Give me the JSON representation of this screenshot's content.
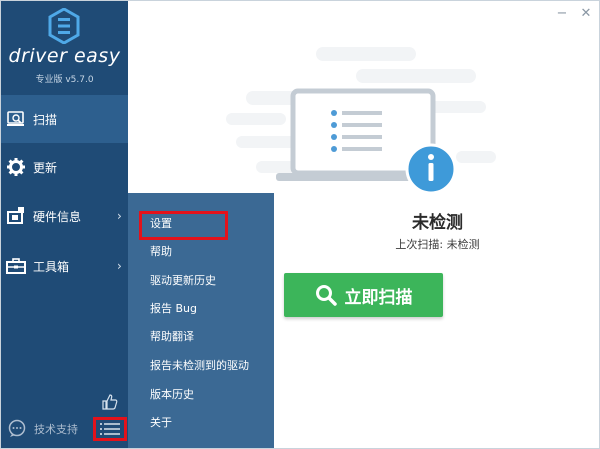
{
  "brand": {
    "name": "driver easy",
    "version": "专业版 v5.7.0"
  },
  "sidebar": {
    "items": [
      {
        "label": "扫描",
        "icon": "scan-icon"
      },
      {
        "label": "更新",
        "icon": "gear-icon"
      },
      {
        "label": "硬件信息",
        "icon": "hardware-info-icon"
      },
      {
        "label": "工具箱",
        "icon": "toolbox-icon"
      }
    ],
    "support_label": "技术支持",
    "active_index": 0
  },
  "dropdown": {
    "items": [
      "设置",
      "帮助",
      "驱动更新历史",
      "报告 Bug",
      "帮助翻译",
      "报告未检测到的驱动",
      "版本历史",
      "关于"
    ]
  },
  "window": {
    "minimize": "−",
    "close": "✕"
  },
  "main": {
    "status_title": "未检测",
    "last_scan": "上次扫描: 未检测",
    "scan_button_label": "立即扫描"
  },
  "colors": {
    "sidebar_bg": "#1f4b76",
    "sidebar_active": "#2d5f8e",
    "dropdown_bg": "#3b6994",
    "scan_button": "#3cb55a",
    "highlight_red": "#e3121b",
    "info_blue": "#3e9ad9"
  }
}
